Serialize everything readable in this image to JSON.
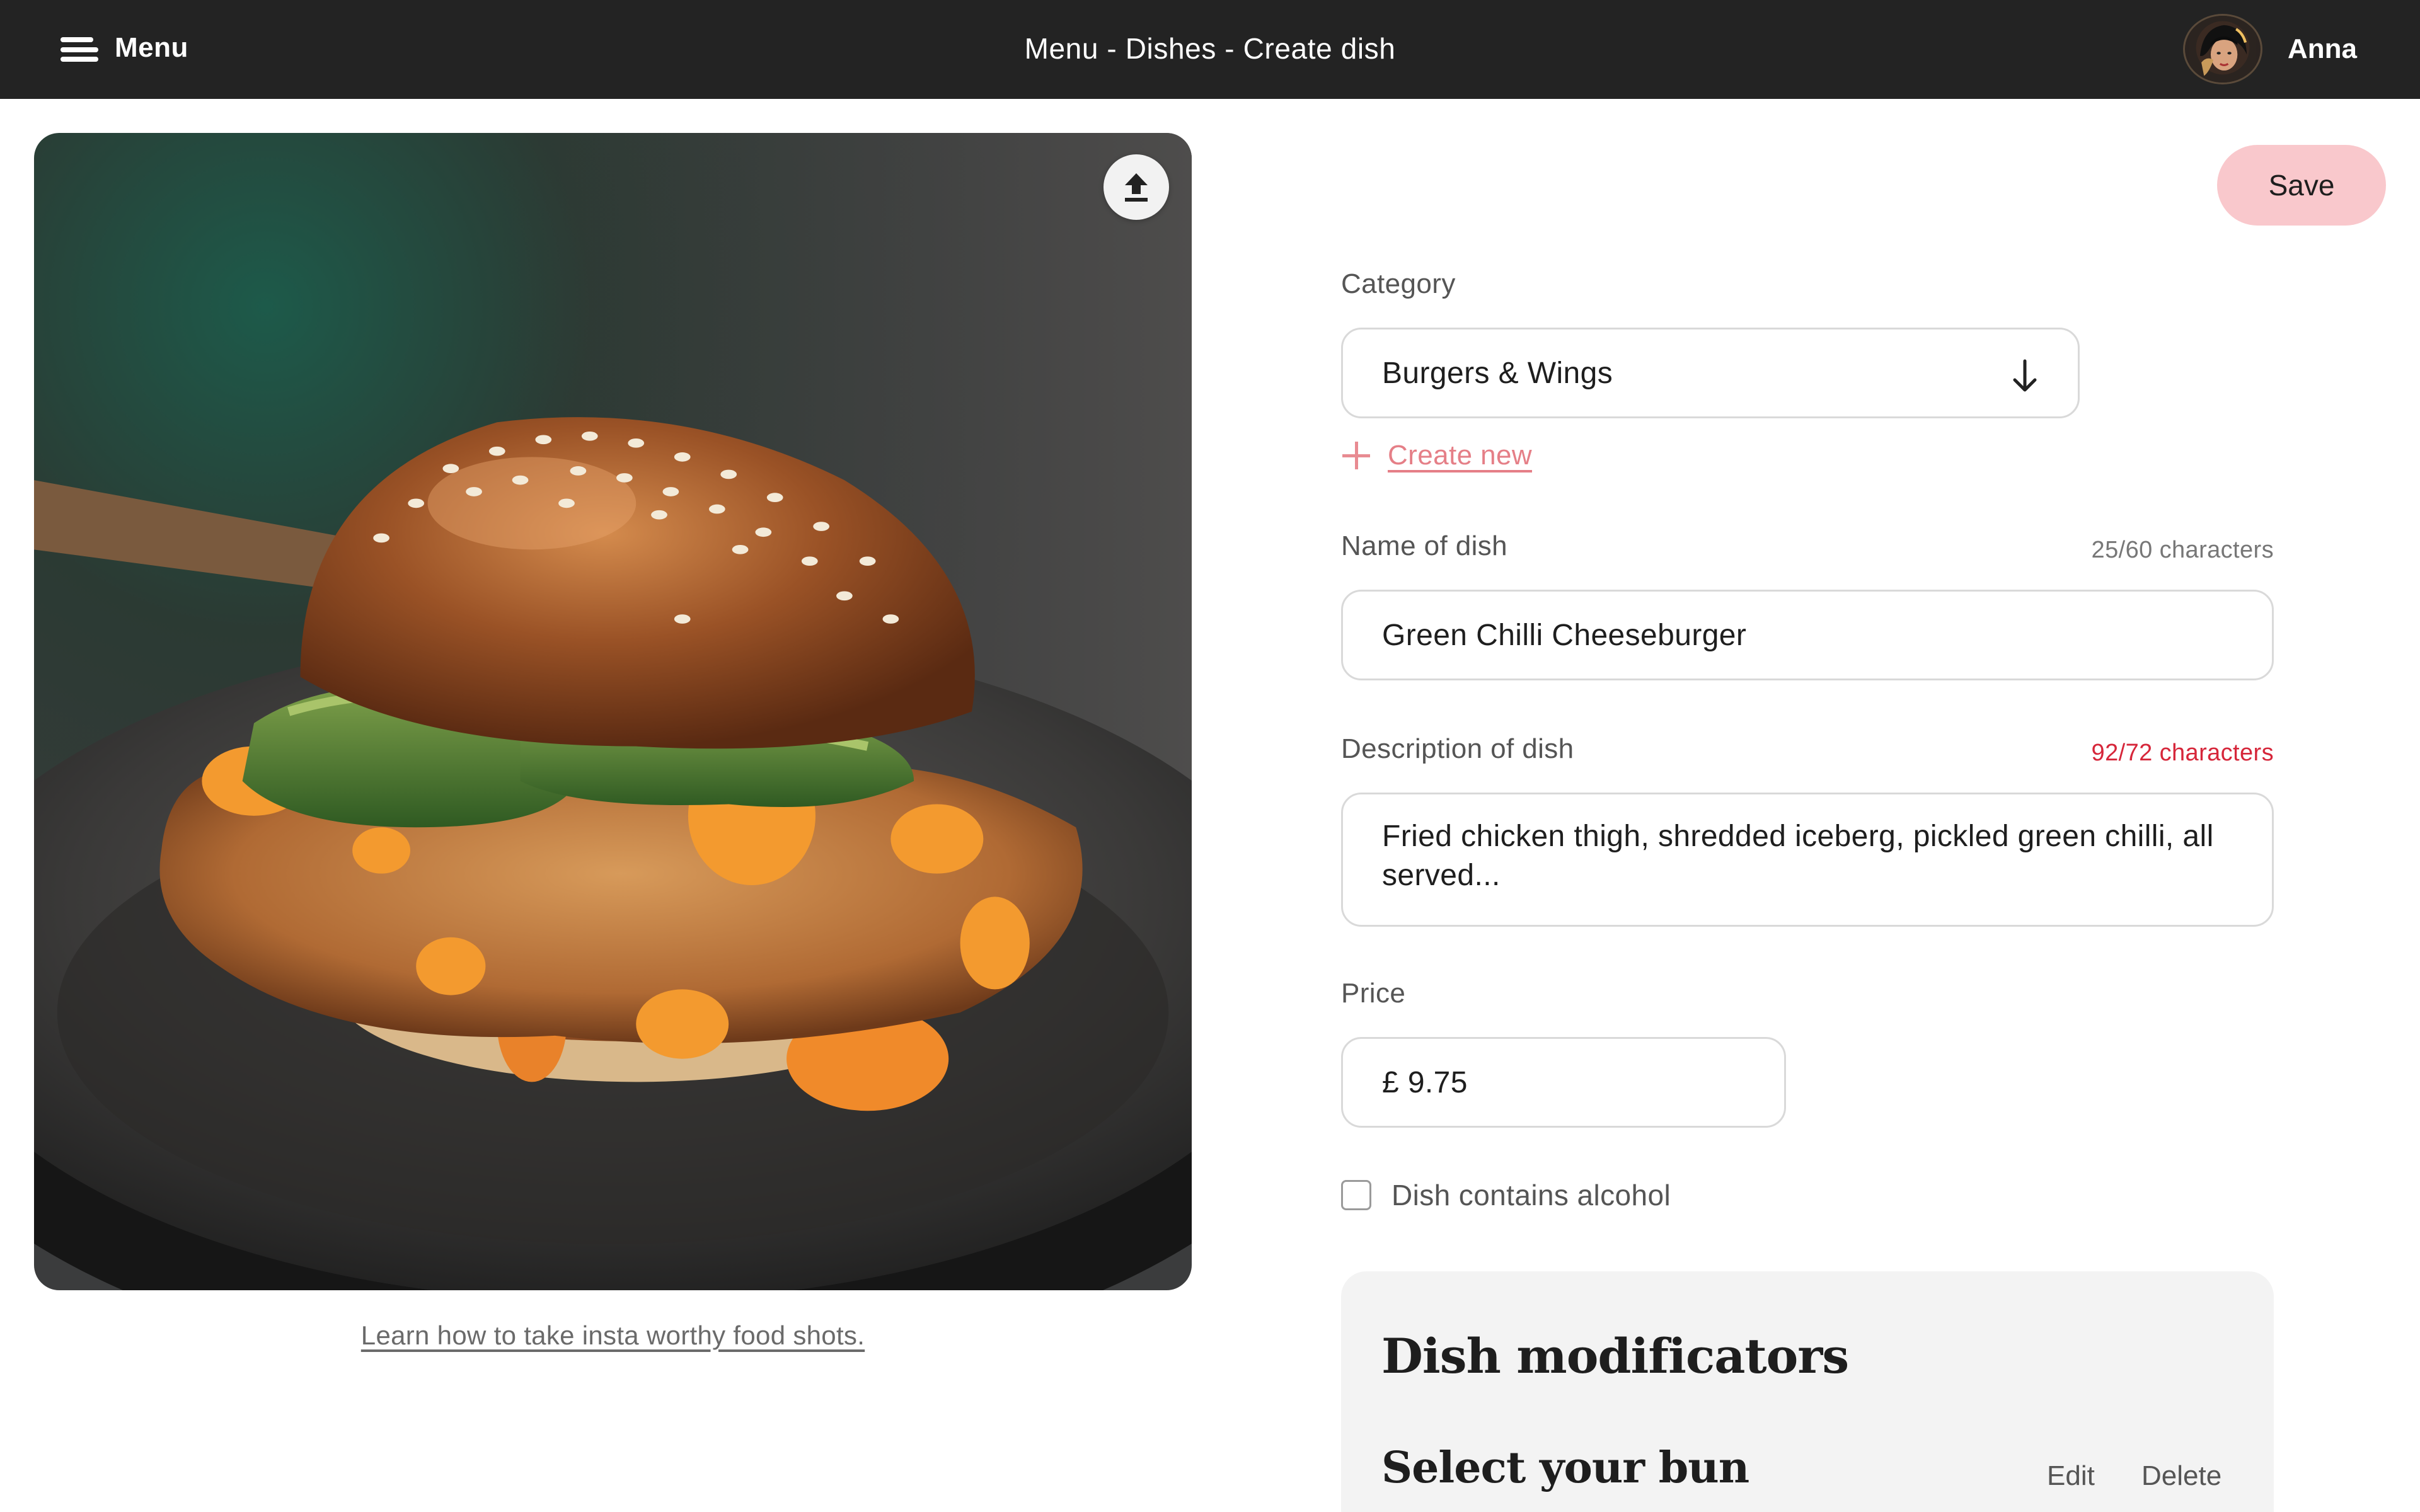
{
  "header": {
    "menu_label": "Menu",
    "breadcrumb": "Menu - Dishes - Create dish",
    "user_name": "Anna",
    "icons": {
      "menu": "hamburger-icon",
      "avatar": "user-avatar"
    }
  },
  "photo": {
    "link_text": "Learn how to take insta worthy food shots.",
    "upload_icon": "upload-icon"
  },
  "actions": {
    "save_label": "Save"
  },
  "form": {
    "category": {
      "label": "Category",
      "value": "Burgers & Wings",
      "icon": "arrow-down-icon",
      "create_new_label": "Create new"
    },
    "name": {
      "label": "Name of dish",
      "counter": "25/60 characters",
      "value": "Green Chilli Cheeseburger"
    },
    "description": {
      "label": "Description of dish",
      "counter": "92/72 characters",
      "value": "Fried chicken thigh, shredded iceberg, pickled green chilli, all served..."
    },
    "price": {
      "label": "Price",
      "value": "£ 9.75"
    },
    "alcohol": {
      "label": "Dish contains alcohol",
      "checked": false
    }
  },
  "modificators": {
    "title": "Dish modificators",
    "group_title": "Select your bun",
    "edit_label": "Edit",
    "delete_label": "Delete"
  },
  "colors": {
    "topbar": "#232323",
    "save_button": "#f9c8cc",
    "accent_link": "#e57f87",
    "error": "#d6263a",
    "panel": "#f3f3f3"
  }
}
